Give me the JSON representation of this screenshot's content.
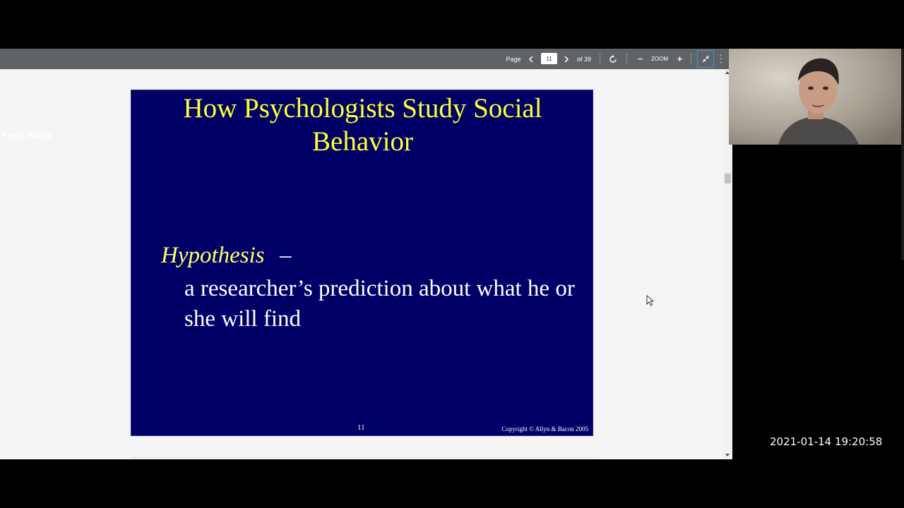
{
  "toolbar": {
    "page_label": "Page",
    "current_page": "11",
    "of_pages": "of 39",
    "zoom_label": "ZOOM",
    "accent_color": "#4a90e2"
  },
  "slide": {
    "title": "How Psychologists Study Social Behavior",
    "term": "Hypothesis",
    "dash": "–",
    "definition": "a researcher’s prediction about what he or she will find",
    "number": "11",
    "copyright": "Copyright © Allyn & Bacon 2005",
    "background_color": "#000066",
    "title_color": "#ffff33"
  },
  "webcam": {
    "name": "Fredy Aviles"
  },
  "overlay": {
    "timestamp": "2021-01-14 19:20:58"
  }
}
